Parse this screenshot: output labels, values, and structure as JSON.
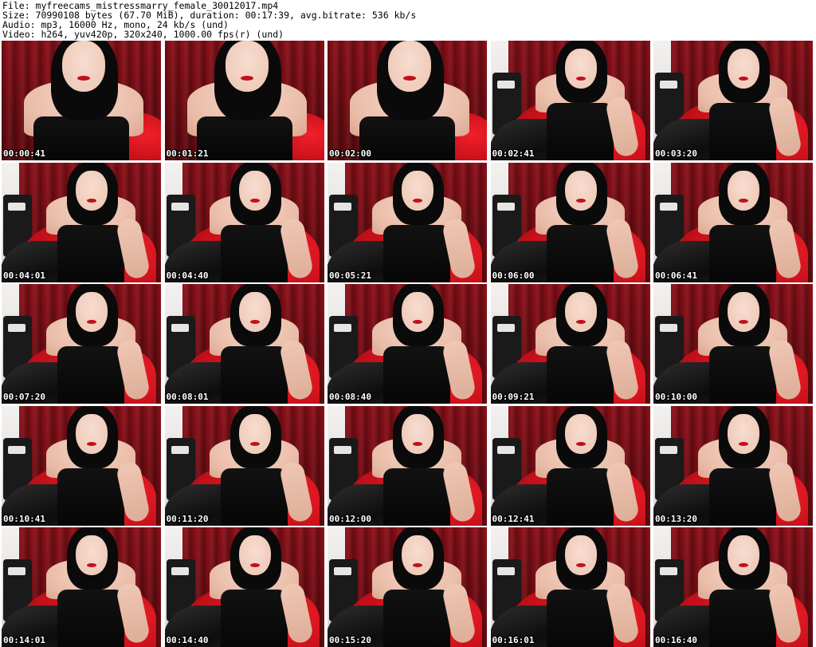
{
  "header": {
    "file": "File: myfreecams_mistressmarry_female_30012017.mp4",
    "size": "Size: 70990108 bytes (67.70 MiB), duration: 00:17:39, avg.bitrate: 536 kb/s",
    "audio": "Audio: mp3, 16000 Hz, mono, 24 kb/s (und)",
    "video": "Video: h264, yuv420p, 320x240, 1000.00 fps(r) (und)"
  },
  "thumbnails": [
    {
      "timestamp": "00:00:41"
    },
    {
      "timestamp": "00:01:21"
    },
    {
      "timestamp": "00:02:00"
    },
    {
      "timestamp": "00:02:41"
    },
    {
      "timestamp": "00:03:20"
    },
    {
      "timestamp": "00:04:01"
    },
    {
      "timestamp": "00:04:40"
    },
    {
      "timestamp": "00:05:21"
    },
    {
      "timestamp": "00:06:00"
    },
    {
      "timestamp": "00:06:41"
    },
    {
      "timestamp": "00:07:20"
    },
    {
      "timestamp": "00:08:01"
    },
    {
      "timestamp": "00:08:40"
    },
    {
      "timestamp": "00:09:21"
    },
    {
      "timestamp": "00:10:00"
    },
    {
      "timestamp": "00:10:41"
    },
    {
      "timestamp": "00:11:20"
    },
    {
      "timestamp": "00:12:00"
    },
    {
      "timestamp": "00:12:41"
    },
    {
      "timestamp": "00:13:20"
    },
    {
      "timestamp": "00:14:01"
    },
    {
      "timestamp": "00:14:40"
    },
    {
      "timestamp": "00:15:20"
    },
    {
      "timestamp": "00:16:01"
    },
    {
      "timestamp": "00:16:40"
    }
  ]
}
